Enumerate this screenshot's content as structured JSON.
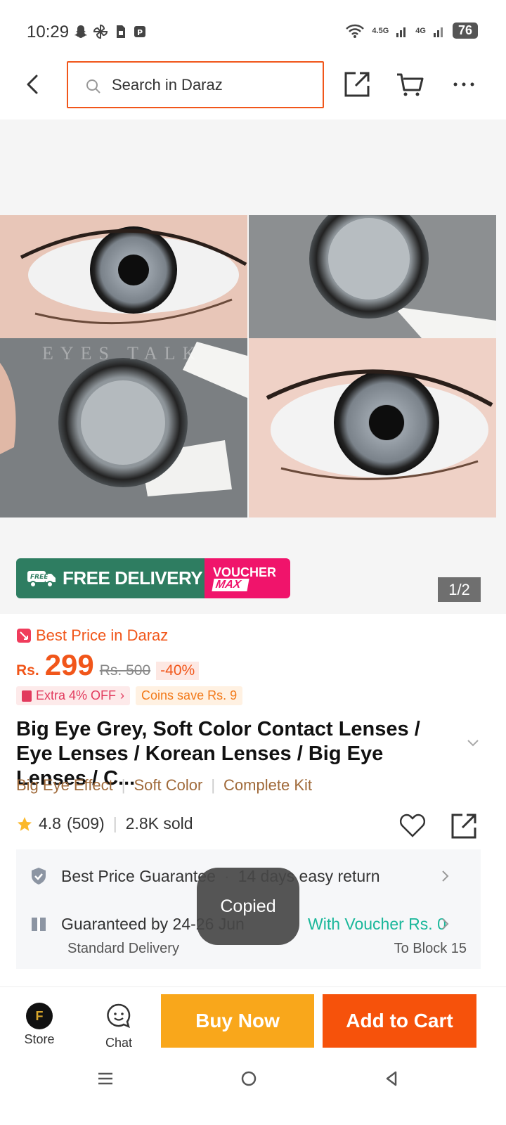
{
  "status_bar": {
    "time": "10:29",
    "network_1": "4.5G",
    "network_2": "4G",
    "battery": "76"
  },
  "top_nav": {
    "search_placeholder": "Search in Daraz"
  },
  "gallery": {
    "image_desc": "contact-lens-collage",
    "image_watermark": "EYES TALK",
    "promo_free_delivery": "FREE DELIVERY",
    "promo_free_badge": "FREE",
    "promo_voucher_line1": "VOUCHER",
    "promo_voucher_line2": "MAX",
    "page_indicator": "1/2"
  },
  "product": {
    "best_price_label": "Best Price in Daraz",
    "currency": "Rs.",
    "price": "299",
    "old_price": "Rs. 500",
    "discount": "-40%",
    "chip_extra": "Extra 4% OFF",
    "chip_coins": "Coins save Rs. 9",
    "title": "Big Eye Grey, Soft Color Contact Lenses / Eye Lenses / Korean Lenses / Big Eye Lenses / C...",
    "tags": [
      "Big Eye Effect",
      "Soft Color",
      "Complete Kit"
    ],
    "rating": "4.8",
    "rating_count": "(509)",
    "sold": "2.8K sold"
  },
  "service": {
    "guarantee": "Best Price Guarantee",
    "returns": "14 days easy return",
    "delivery_guarantee": "Guaranteed by 24-26 Jun",
    "voucher": "With Voucher Rs. 0",
    "delivery_type": "Standard Delivery",
    "delivery_to": "To Block 15"
  },
  "toast": "Copied",
  "bottom_bar": {
    "store_label": "Store",
    "chat_label": "Chat",
    "buy_now": "Buy Now",
    "add_to_cart": "Add to Cart"
  },
  "colors": {
    "brand_orange": "#f1561a",
    "buy_now": "#f9a71b",
    "add_to_cart": "#f6520b",
    "delivery_green": "#2e7d61",
    "voucher_pink": "#f0146b",
    "voucher_text": "#19b79a"
  }
}
